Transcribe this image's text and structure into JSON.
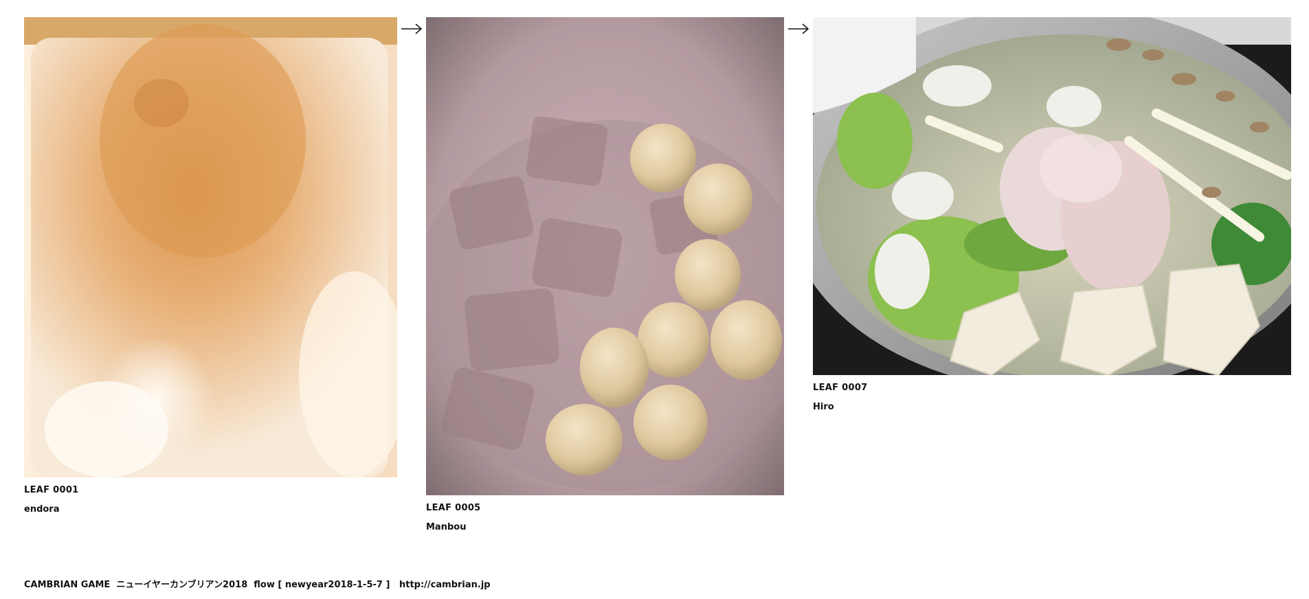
{
  "leaves": [
    {
      "code": "LEAF 0001",
      "author": "endora",
      "image_desc": "blurry-warm-photo"
    },
    {
      "code": "LEAF 0005",
      "author": "Manbou",
      "image_desc": "simmered-eggs-pot-photo"
    },
    {
      "code": "LEAF 0007",
      "author": "Hiro",
      "image_desc": "hotpot-tofu-cabbage-photo"
    }
  ],
  "arrows": [
    "arrow-right-icon",
    "arrow-right-icon"
  ],
  "footer": {
    "label": "CAMBRIAN GAME  ニューイヤーカンブリアン2018  flow [ newyear2018-1-5-7 ]   ",
    "link_text": "http://cambrian.jp"
  }
}
